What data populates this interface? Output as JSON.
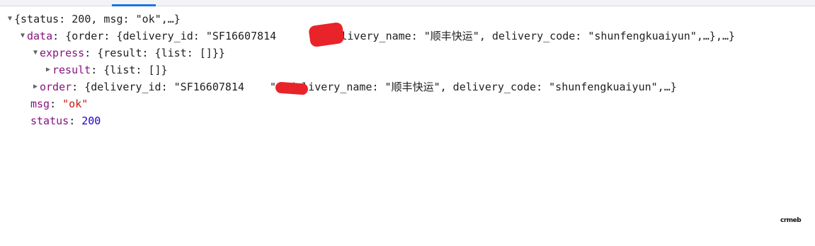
{
  "tree": {
    "root_summary": "{status: 200, msg: \"ok\",…}",
    "data_row": {
      "key": "data",
      "summary": "{order: {delivery_id: \"SF16607814",
      "summary_tail": "\", delivery_name: \"顺丰快运\", delivery_code: \"shunfengkuaiyun\",…},…}"
    },
    "express_row": {
      "key": "express",
      "summary": "{result: {list: []}}"
    },
    "result_row": {
      "key": "result",
      "summary": "{list: []}"
    },
    "order_row": {
      "key": "order",
      "summary": "{delivery_id: \"SF16607814",
      "summary_tail": "\", delivery_name: \"顺丰快运\", delivery_code: \"shunfengkuaiyun\",…}"
    },
    "msg_row": {
      "key": "msg",
      "value": "\"ok\""
    },
    "status_row": {
      "key": "status",
      "value": "200"
    }
  },
  "watermark": "crmeb",
  "icons": {
    "expanded": "triangle-down-icon",
    "collapsed": "triangle-right-icon"
  },
  "colors": {
    "key": "#881280",
    "string": "#c41a16",
    "number": "#1c00cf",
    "redaction": "#e8242a",
    "accent": "#1a73e8"
  }
}
